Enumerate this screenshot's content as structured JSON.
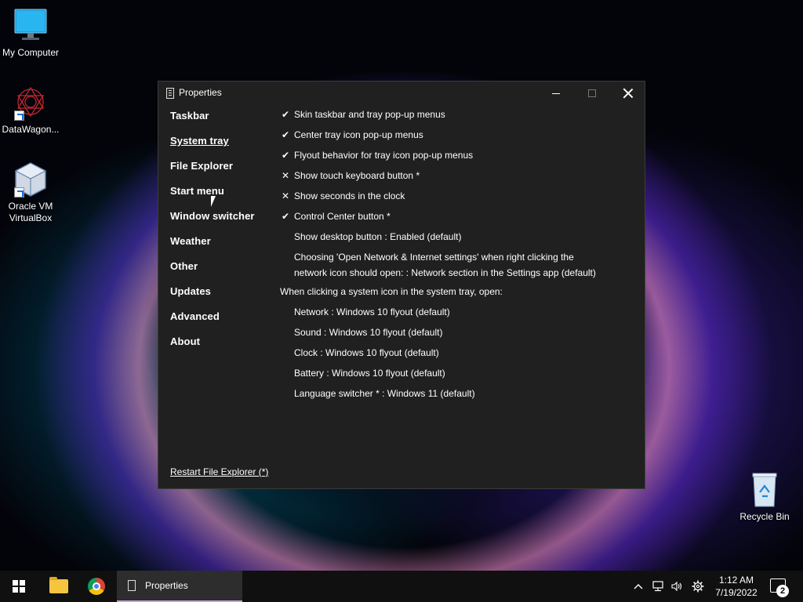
{
  "desktop": {
    "icons": [
      {
        "label": "My Computer",
        "icon": "monitor-icon"
      },
      {
        "label": "DataWagon...",
        "icon": "datawagon-logo-icon"
      },
      {
        "label": "Oracle VM VirtualBox",
        "icon": "virtualbox-icon"
      },
      {
        "label": "Recycle Bin",
        "icon": "recycle-bin-icon"
      }
    ]
  },
  "window": {
    "title": "Properties",
    "nav": [
      "Taskbar",
      "System tray",
      "File Explorer",
      "Start menu",
      "Window switcher",
      "Weather",
      "Other",
      "Updates",
      "Advanced",
      "About"
    ],
    "active_nav": "System tray",
    "options": [
      {
        "mark": "✔",
        "label": "Skin taskbar and tray pop-up menus"
      },
      {
        "mark": "✔",
        "label": "Center tray icon pop-up menus"
      },
      {
        "mark": "✔",
        "label": "Flyout behavior for tray icon pop-up menus"
      },
      {
        "mark": "✕",
        "label": "Show touch keyboard button *"
      },
      {
        "mark": "✕",
        "label": "Show seconds in the clock"
      },
      {
        "mark": "✔",
        "label": "Control Center button *"
      },
      {
        "mark": "",
        "label": "Show desktop button : Enabled (default)"
      },
      {
        "mark": "",
        "label": "Choosing 'Open Network & Internet settings' when right clicking the network icon should open: : Network section in the Settings app (default)"
      }
    ],
    "system_icon_heading": "When clicking a system icon in the system tray, open:",
    "system_icon_options": [
      "Network : Windows 10 flyout (default)",
      "Sound : Windows 10 flyout (default)",
      "Clock : Windows 10 flyout (default)",
      "Battery : Windows 10 flyout (default)",
      "Language switcher * : Windows 11 (default)"
    ],
    "restart_link": "Restart File Explorer (*)"
  },
  "taskbar": {
    "active_task": "Properties",
    "clock_time": "1:12 AM",
    "clock_date": "7/19/2022",
    "notification_count": "2"
  }
}
